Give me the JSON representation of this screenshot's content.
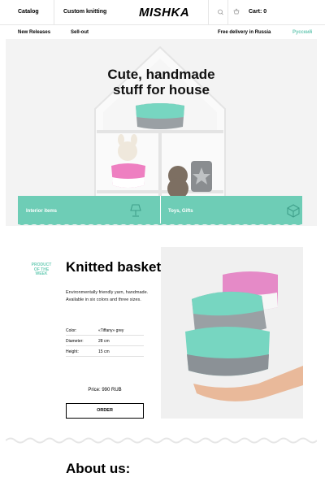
{
  "header": {
    "nav": [
      {
        "label": "Catalog"
      },
      {
        "label": "Custom knitting"
      }
    ],
    "logo": "MISHKA",
    "search_icon": "search-icon",
    "cart": {
      "icon": "basket-icon",
      "label": "Cart: 0"
    }
  },
  "subnav": {
    "left": [
      {
        "label": "New Releases"
      },
      {
        "label": "Sell-out"
      }
    ],
    "delivery": "Free delivery in Russia",
    "language": "Русский"
  },
  "hero": {
    "title_line1": "Cute, handmade",
    "title_line2": "stuff for house",
    "tabs": [
      {
        "label": "Interior items",
        "icon": "lamp-icon"
      },
      {
        "label": "Toys, Gifts",
        "icon": "gift-box-icon"
      }
    ]
  },
  "product": {
    "badge": "PRODUCT OF THE WEEK",
    "title": "Knitted baskets",
    "description": "Environmentally friendly yarn, handmade. Available in six colors and three sizes.",
    "specs": [
      {
        "key": "Color:",
        "value": "«Tiffany» grey"
      },
      {
        "key": "Diameter:",
        "value": "28 cm"
      },
      {
        "key": "Height:",
        "value": "15 cm"
      }
    ],
    "price": "Price: 990 RUB",
    "order_label": "ORDER"
  },
  "about": {
    "title": "About us:"
  },
  "colors": {
    "accent": "#6ecdb6",
    "hero_bg": "#f3f3f3",
    "text": "#000000"
  }
}
